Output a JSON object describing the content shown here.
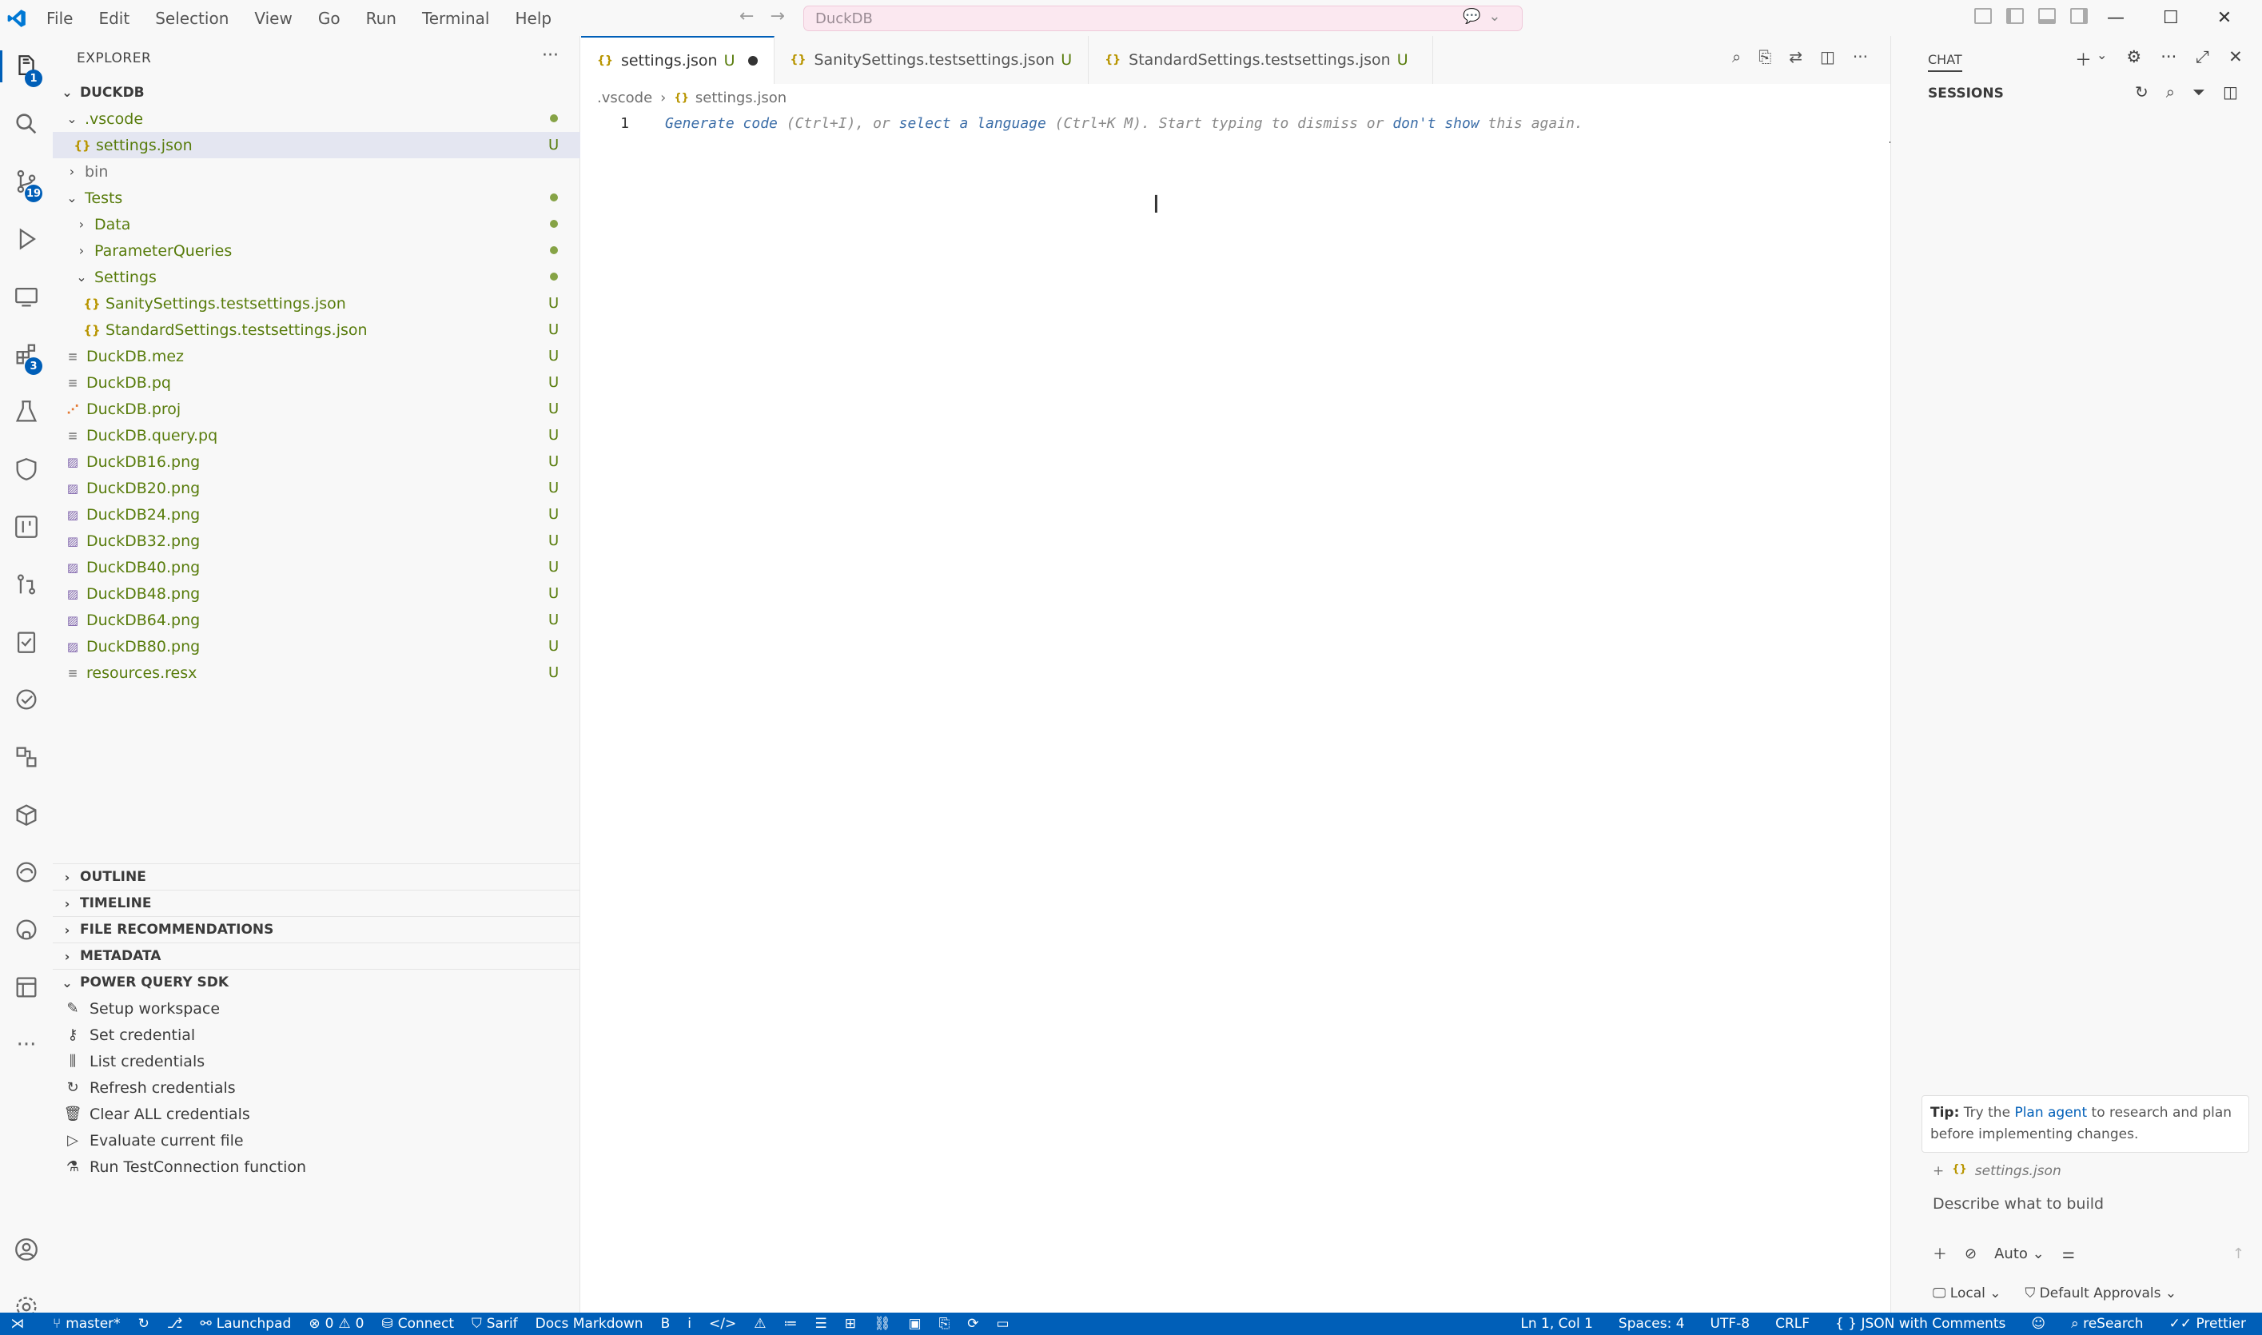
{
  "titlebar": {
    "menu": [
      "File",
      "Edit",
      "Selection",
      "View",
      "Go",
      "Run",
      "Terminal",
      "Help"
    ],
    "search": "DuckDB"
  },
  "activity_bar": {
    "items": [
      {
        "icon": "explorer-icon",
        "badge": "1"
      },
      {
        "icon": "search-icon",
        "badge": ""
      },
      {
        "icon": "source-control-icon",
        "badge": "19"
      },
      {
        "icon": "run-debug-icon",
        "badge": ""
      },
      {
        "icon": "remote-explorer-icon",
        "badge": ""
      },
      {
        "icon": "extensions-icon",
        "badge": "3"
      },
      {
        "icon": "testing-icon",
        "badge": ""
      },
      {
        "icon": "security-icon",
        "badge": ""
      },
      {
        "icon": "git-graph-icon",
        "badge": ""
      },
      {
        "icon": "pull-requests-icon",
        "badge": ""
      },
      {
        "icon": "tasks-icon",
        "badge": ""
      },
      {
        "icon": "checklist-icon",
        "badge": ""
      },
      {
        "icon": "diagram-icon",
        "badge": ""
      },
      {
        "icon": "package-icon",
        "badge": ""
      },
      {
        "icon": "edge-icon",
        "badge": ""
      },
      {
        "icon": "github-icon",
        "badge": ""
      },
      {
        "icon": "server-icon",
        "badge": ""
      },
      {
        "icon": "more-icon",
        "badge": ""
      }
    ],
    "bottom": [
      {
        "icon": "account-icon"
      },
      {
        "icon": "manage-gear-icon"
      }
    ]
  },
  "explorer": {
    "title": "EXPLORER",
    "root": "DUCKDB",
    "tree": [
      {
        "label": ".vscode",
        "depth": 0,
        "type": "folder-open",
        "status": "dot"
      },
      {
        "label": "settings.json",
        "depth": 1,
        "type": "json",
        "status": "U",
        "selected": true
      },
      {
        "label": "bin",
        "depth": 0,
        "type": "folder-closed",
        "status": "",
        "muted": true
      },
      {
        "label": "Tests",
        "depth": 0,
        "type": "folder-open",
        "status": "dot"
      },
      {
        "label": "Data",
        "depth": 1,
        "type": "folder-closed",
        "status": "dot"
      },
      {
        "label": "ParameterQueries",
        "depth": 1,
        "type": "folder-closed",
        "status": "dot"
      },
      {
        "label": "Settings",
        "depth": 1,
        "type": "folder-open",
        "status": "dot"
      },
      {
        "label": "SanitySettings.testsettings.json",
        "depth": 2,
        "type": "json",
        "status": "U"
      },
      {
        "label": "StandardSettings.testsettings.json",
        "depth": 2,
        "type": "json",
        "status": "U"
      },
      {
        "label": "DuckDB.mez",
        "depth": 0,
        "type": "file",
        "status": "U"
      },
      {
        "label": "DuckDB.pq",
        "depth": 0,
        "type": "file",
        "status": "U"
      },
      {
        "label": "DuckDB.proj",
        "depth": 0,
        "type": "rss",
        "status": "U"
      },
      {
        "label": "DuckDB.query.pq",
        "depth": 0,
        "type": "file",
        "status": "U"
      },
      {
        "label": "DuckDB16.png",
        "depth": 0,
        "type": "image",
        "status": "U"
      },
      {
        "label": "DuckDB20.png",
        "depth": 0,
        "type": "image",
        "status": "U"
      },
      {
        "label": "DuckDB24.png",
        "depth": 0,
        "type": "image",
        "status": "U"
      },
      {
        "label": "DuckDB32.png",
        "depth": 0,
        "type": "image",
        "status": "U"
      },
      {
        "label": "DuckDB40.png",
        "depth": 0,
        "type": "image",
        "status": "U"
      },
      {
        "label": "DuckDB48.png",
        "depth": 0,
        "type": "image",
        "status": "U"
      },
      {
        "label": "DuckDB64.png",
        "depth": 0,
        "type": "image",
        "status": "U"
      },
      {
        "label": "DuckDB80.png",
        "depth": 0,
        "type": "image",
        "status": "U"
      },
      {
        "label": "resources.resx",
        "depth": 0,
        "type": "file",
        "status": "U"
      }
    ],
    "sections": [
      "OUTLINE",
      "TIMELINE",
      "FILE RECOMMENDATIONS",
      "METADATA"
    ],
    "pq_sdk": {
      "title": "POWER QUERY SDK",
      "items": [
        {
          "label": "Setup workspace",
          "icon": "pencil-icon"
        },
        {
          "label": "Set credential",
          "icon": "key-icon"
        },
        {
          "label": "List credentials",
          "icon": "library-icon"
        },
        {
          "label": "Refresh credentials",
          "icon": "refresh-icon"
        },
        {
          "label": "Clear ALL credentials",
          "icon": "trash-icon"
        },
        {
          "label": "Evaluate current file",
          "icon": "play-icon"
        },
        {
          "label": "Run TestConnection function",
          "icon": "beaker-icon"
        }
      ]
    }
  },
  "editor": {
    "tabs": [
      {
        "label": "settings.json",
        "status": "U",
        "dirty": true,
        "active": true
      },
      {
        "label": "SanitySettings.testsettings.json",
        "status": "U",
        "dirty": false,
        "active": false
      },
      {
        "label": "StandardSettings.testsettings.json",
        "status": "U",
        "dirty": false,
        "active": false
      }
    ],
    "breadcrumb": [
      ".vscode",
      "settings.json"
    ],
    "line_number": "1",
    "hint": {
      "link1": "Generate code",
      "text1": " (Ctrl+I), or ",
      "link2": "select a language",
      "text2": " (Ctrl+K M). Start typing to dismiss or ",
      "link3": "don't show",
      "text3": " this again."
    }
  },
  "chat": {
    "title": "CHAT",
    "sessions_label": "SESSIONS",
    "tip_label": "Tip:",
    "tip_text1": " Try the ",
    "tip_link": "Plan agent",
    "tip_text2": " to research and plan before implementing changes.",
    "attachment": "settings.json",
    "input_placeholder": "Describe what to build",
    "mode": "Auto",
    "location": "Local",
    "approvals": "Default Approvals"
  },
  "statusbar": {
    "branch": "master*",
    "launchpad": "Launchpad",
    "errors": "0",
    "warnings": "0",
    "connect": "Connect",
    "sarif": "Sarif",
    "docs_markdown": "Docs Markdown",
    "bold": "B",
    "italic": "i",
    "position": "Ln 1, Col 1",
    "spaces": "Spaces: 4",
    "encoding": "UTF-8",
    "eol": "CRLF",
    "language": "JSON with Comments",
    "research": "reSearch",
    "prettier": "Prettier"
  },
  "colors": {
    "accent": "#005fb8",
    "untracked": "#587c0c",
    "json_icon": "#b89500"
  }
}
